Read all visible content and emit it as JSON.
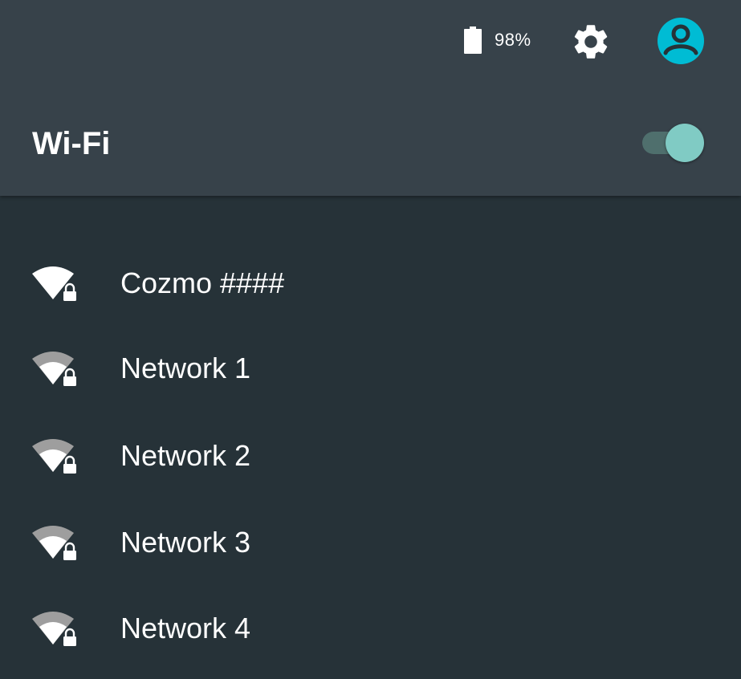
{
  "status_bar": {
    "battery_icon": "battery-full-icon",
    "battery_percent": "98%",
    "settings_icon": "gear-icon",
    "account_icon": "account-circle-icon",
    "account_color": "#00bcd4"
  },
  "header": {
    "title": "Wi-Fi",
    "toggle_state": "on",
    "toggle_color": "#80cbc4"
  },
  "networks": [
    {
      "label": "Cozmo ####",
      "signal_bars": 4,
      "locked": true,
      "icon": "wifi-lock-icon"
    },
    {
      "label": "Network 1",
      "signal_bars": 3,
      "locked": true,
      "icon": "wifi-lock-icon"
    },
    {
      "label": "Network 2",
      "signal_bars": 3,
      "locked": true,
      "icon": "wifi-lock-icon"
    },
    {
      "label": "Network 3",
      "signal_bars": 3,
      "locked": true,
      "icon": "wifi-lock-icon"
    },
    {
      "label": "Network 4",
      "signal_bars": 3,
      "locked": true,
      "icon": "wifi-lock-icon"
    }
  ],
  "colors": {
    "background": "#263238",
    "app_bar": "#37424a",
    "text": "#ffffff",
    "signal_weak": "#9e9e9e"
  }
}
